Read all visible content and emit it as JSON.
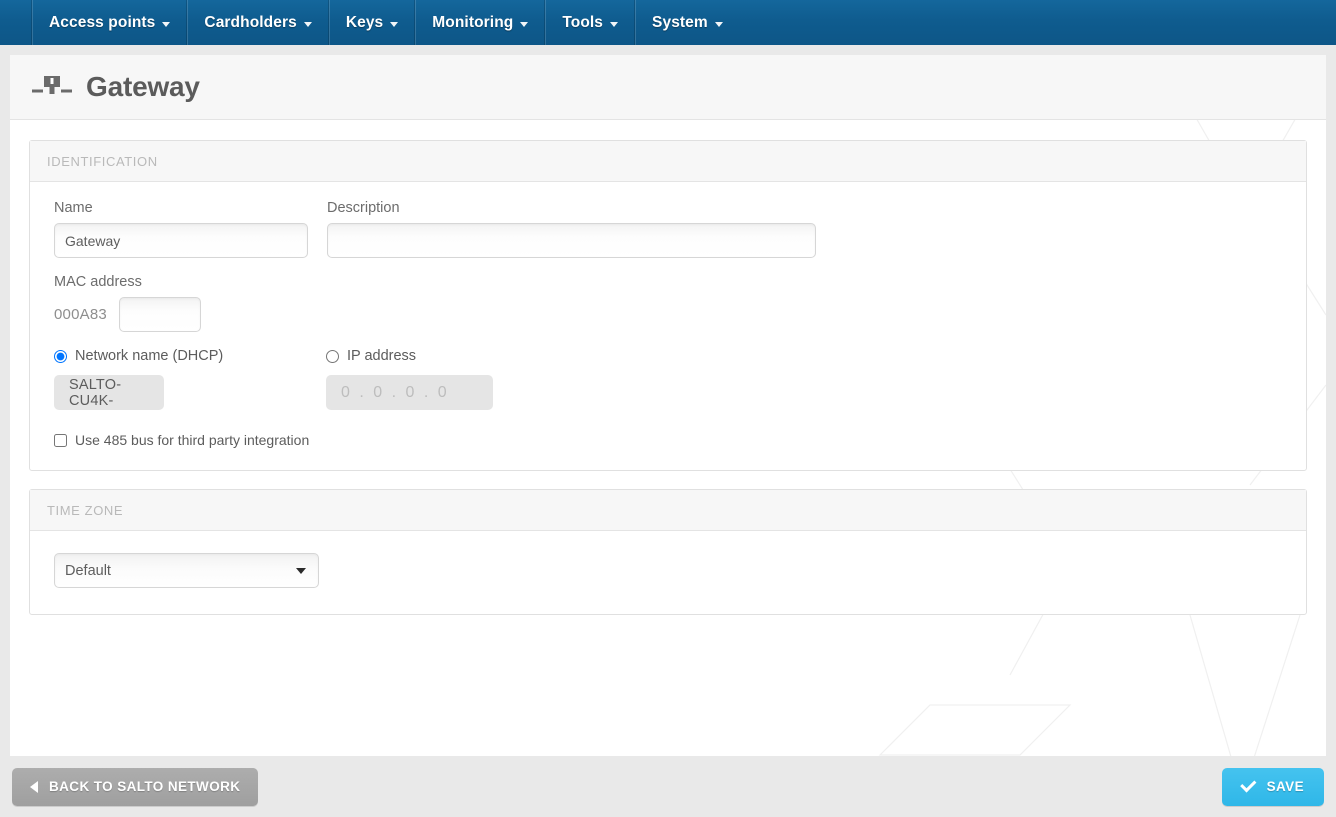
{
  "nav": {
    "items": [
      {
        "label": "Access points",
        "icon": "chevron-down-icon"
      },
      {
        "label": "Cardholders",
        "icon": "chevron-down-icon"
      },
      {
        "label": "Keys",
        "icon": "chevron-down-icon"
      },
      {
        "label": "Monitoring",
        "icon": "chevron-down-icon"
      },
      {
        "label": "Tools",
        "icon": "chevron-down-icon"
      },
      {
        "label": "System",
        "icon": "chevron-down-icon"
      }
    ]
  },
  "header": {
    "title": "Gateway",
    "icon": "network-node-icon"
  },
  "identification": {
    "section_title": "IDENTIFICATION",
    "name_label": "Name",
    "name_value": "Gateway",
    "name_placeholder": "",
    "description_label": "Description",
    "description_value": "",
    "description_placeholder": "",
    "mac_label": "MAC address",
    "mac_prefix": "000A83",
    "mac_value": "",
    "mac_placeholder": "",
    "radio_dhcp_label": "Network name (DHCP)",
    "radio_dhcp_selected": true,
    "radio_ip_label": "IP address",
    "radio_ip_selected": false,
    "dhcp_value": "SALTO-CU4K-",
    "ip_value": "0 . 0 . 0 . 0",
    "checkbox_485_label": "Use 485 bus for third party integration",
    "checkbox_485_checked": false
  },
  "timezone": {
    "section_title": "TIME ZONE",
    "selected": "Default",
    "options": [
      "Default"
    ]
  },
  "footer": {
    "back_label": "BACK TO SALTO NETWORK",
    "back_icon": "arrow-left-icon",
    "save_label": "SAVE",
    "save_icon": "check-icon"
  },
  "colors": {
    "nav_blue": "#0f5c8f",
    "save_blue": "#33bbea",
    "back_gray": "#a5a5a5",
    "title_gray": "#5b5b5b",
    "section_label_gray": "#b9b9b9"
  }
}
